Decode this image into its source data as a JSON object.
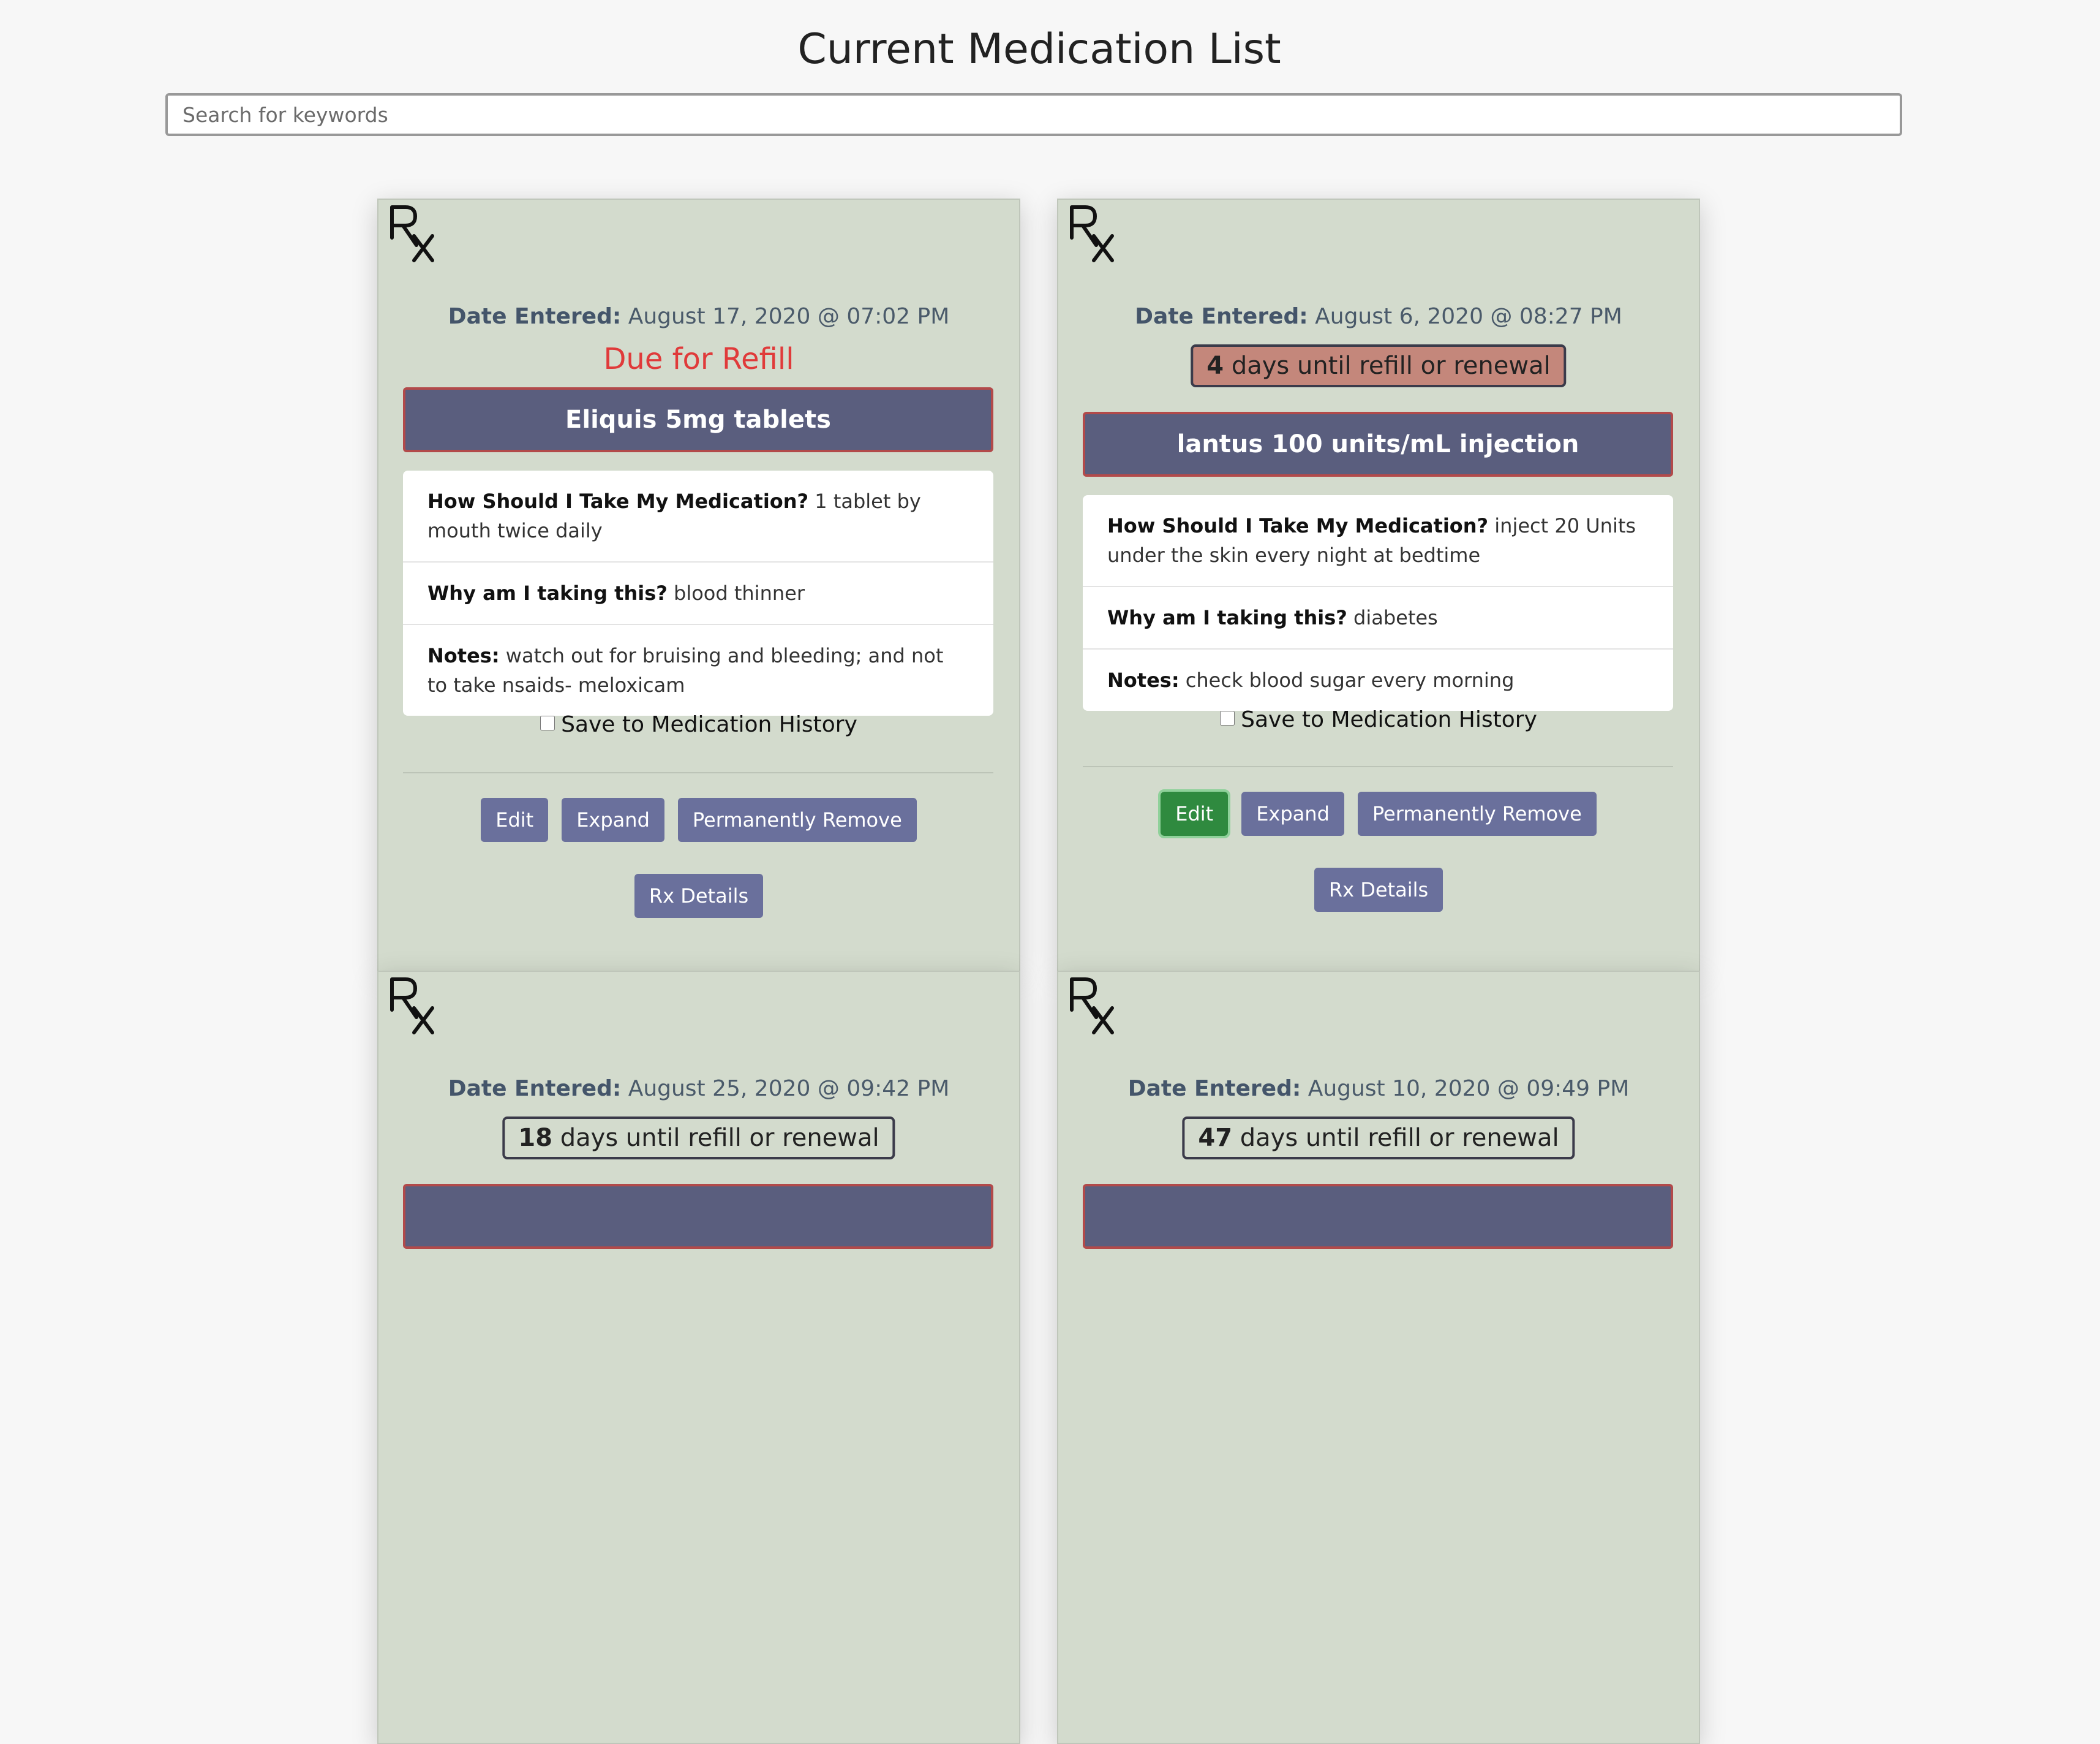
{
  "page": {
    "title": "Current Medication List",
    "search_placeholder": "Search for keywords"
  },
  "labels": {
    "date_entered": "Date Entered:",
    "how_to_take": "How Should I Take My Medication?",
    "why_taking": "Why am I taking this?",
    "notes": "Notes:",
    "save_history": "Save to Medication History",
    "refill_suffix": "days until refill or renewal"
  },
  "buttons": {
    "edit": "Edit",
    "expand": "Expand",
    "remove": "Permanently Remove",
    "rx_details": "Rx Details"
  },
  "cards": [
    {
      "date": "August 17, 2020 @ 07:02 PM",
      "refill_status": "Due for Refill",
      "name": "Eliquis 5mg tablets",
      "how": "1 tablet by mouth twice daily",
      "why": "blood thinner",
      "notes": "watch out for bruising and bleeding; and not to take nsaids- meloxicam"
    },
    {
      "date": "August 6, 2020 @ 08:27 PM",
      "refill_days": "4",
      "name": "lantus 100 units/mL injection",
      "how": "inject 20 Units under the skin every night at bedtime",
      "why": "diabetes",
      "notes": "check blood sugar every morning"
    },
    {
      "date": "August 25, 2020 @ 09:42 PM",
      "refill_days": "18"
    },
    {
      "date": "August 10, 2020 @ 09:49 PM",
      "refill_days": "47"
    }
  ],
  "colors": {
    "card_bg": "#d3dbcd",
    "med_name_bg": "#5a5e7e",
    "button_bg": "#6a709c",
    "due_red": "#e03a3a",
    "warn_bg": "#c4877b",
    "active_green": "#2f8a3f"
  },
  "icons": {
    "rx": "rx-icon"
  }
}
